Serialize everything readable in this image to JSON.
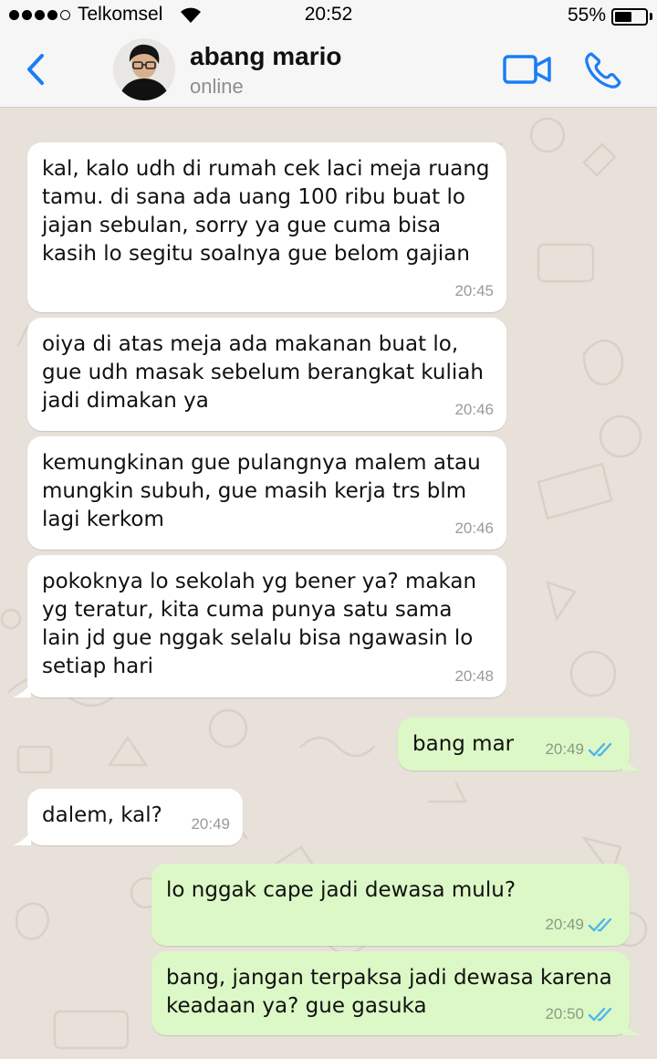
{
  "status_bar": {
    "carrier": "Telkomsel",
    "time": "20:52",
    "battery_percent": "55%",
    "battery_level": 0.55,
    "signal_bars": 4
  },
  "header": {
    "contact_name": "abang mario",
    "contact_status": "online",
    "accent_color": "#1a7ef5"
  },
  "messages": [
    {
      "direction": "incoming",
      "text": "kal, kalo udh di rumah cek laci meja ruang tamu. di sana ada uang 100 ribu buat lo jajan sebulan, sorry ya gue cuma bisa kasih lo segitu soalnya gue belom gajian",
      "time": "20:45"
    },
    {
      "direction": "incoming",
      "text": "oiya di atas meja ada makanan buat lo, gue udh masak sebelum berangkat kuliah jadi dimakan ya",
      "time": "20:46"
    },
    {
      "direction": "incoming",
      "text": "kemungkinan gue pulangnya malem atau mungkin subuh, gue masih kerja trs blm lagi kerkom",
      "time": "20:46"
    },
    {
      "direction": "incoming",
      "text": "pokoknya lo sekolah yg bener ya? makan yg teratur, kita cuma punya satu sama lain jd gue nggak selalu bisa ngawasin lo setiap hari",
      "time": "20:48"
    },
    {
      "direction": "outgoing",
      "text": "bang mar",
      "time": "20:49",
      "read": true
    },
    {
      "direction": "incoming",
      "text": "dalem, kal?",
      "time": "20:49"
    },
    {
      "direction": "outgoing",
      "text": "lo nggak cape jadi dewasa mulu?",
      "time": "20:49",
      "read": true
    },
    {
      "direction": "outgoing",
      "text": "bang, jangan terpaksa jadi dewasa karena keadaan ya? gue gasuka",
      "time": "20:50",
      "read": true
    }
  ],
  "colors": {
    "incoming_bubble": "#ffffff",
    "outgoing_bubble": "#dcf8c6",
    "read_ticks": "#4fb6ec",
    "chat_background": "#e7e1d9"
  }
}
